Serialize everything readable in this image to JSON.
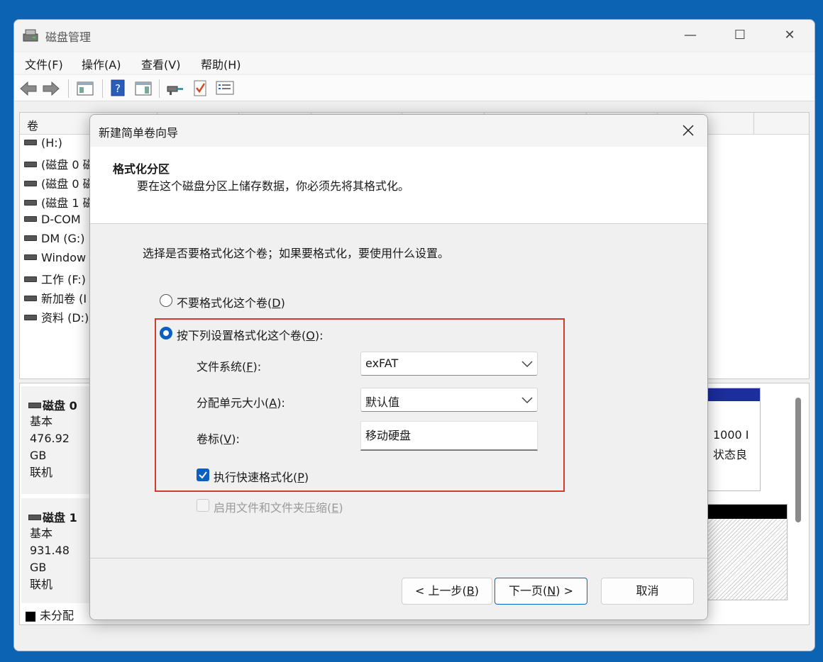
{
  "app": {
    "title": "磁盘管理",
    "window_controls": {
      "minimize": "—",
      "maximize": "☐",
      "close": "✕"
    }
  },
  "menubar": {
    "items": [
      {
        "label": "文件(F)"
      },
      {
        "label": "操作(A)"
      },
      {
        "label": "查看(V)"
      },
      {
        "label": "帮助(H)"
      }
    ]
  },
  "toolbar": {
    "icons": [
      "back-arrow-icon",
      "forward-arrow-icon",
      "console-tree-icon",
      "help-icon",
      "properties-icon",
      "connect-icon",
      "check-icon",
      "list-icon"
    ]
  },
  "volume_list": {
    "header": "卷",
    "items": [
      {
        "label": "(H:)"
      },
      {
        "label": "(磁盘 0 磁"
      },
      {
        "label": "(磁盘 0 磁"
      },
      {
        "label": "(磁盘 1 磁"
      },
      {
        "label": "D-COM"
      },
      {
        "label": "DM (G:)"
      },
      {
        "label": "Window"
      },
      {
        "label": "工作 (F:)"
      },
      {
        "label": "新加卷 (I"
      },
      {
        "label": "资料 (D:)"
      }
    ]
  },
  "disks": [
    {
      "name": "磁盘 0",
      "type": "基本",
      "size": "476.92 GB",
      "status": "联机"
    },
    {
      "name": "磁盘 1",
      "type": "基本",
      "size": "931.48 GB",
      "status": "联机"
    }
  ],
  "right_fragment": {
    "size": "1000 I",
    "status": "状态良"
  },
  "legend": {
    "unallocated": "未分配"
  },
  "dialog": {
    "title": "新建简单卷向导",
    "header_title": "格式化分区",
    "header_subtitle": "要在这个磁盘分区上储存数据，你必须先将其格式化。",
    "instruction": "选择是否要格式化这个卷；如果要格式化，要使用什么设置。",
    "option_no_format": {
      "label": "不要格式化这个卷(",
      "key": "D",
      "end": ")",
      "selected": false
    },
    "option_format": {
      "label": "按下列设置格式化这个卷(",
      "key": "O",
      "end": "):",
      "selected": true
    },
    "fields": {
      "filesystem": {
        "label": "文件系统(",
        "key": "F",
        "end": "):",
        "value": "exFAT"
      },
      "allocation": {
        "label": "分配单元大小(",
        "key": "A",
        "end": "):",
        "value": "默认值"
      },
      "volume_label": {
        "label": "卷标(",
        "key": "V",
        "end": "):",
        "value": "移动硬盘"
      }
    },
    "quick_format": {
      "label": "执行快速格式化(",
      "key": "P",
      "end": ")",
      "checked": true
    },
    "compression": {
      "label": "启用文件和文件夹压缩(",
      "key": "E",
      "end": ")",
      "checked": false,
      "enabled": false
    },
    "buttons": {
      "back": {
        "pre": "< 上一步(",
        "key": "B",
        "end": ")"
      },
      "next": {
        "pre": "下一页(",
        "key": "N",
        "end": ") >"
      },
      "cancel": "取消"
    },
    "colors": {
      "accent": "#0a5fc0",
      "highlight_box": "#d13c2a"
    }
  }
}
